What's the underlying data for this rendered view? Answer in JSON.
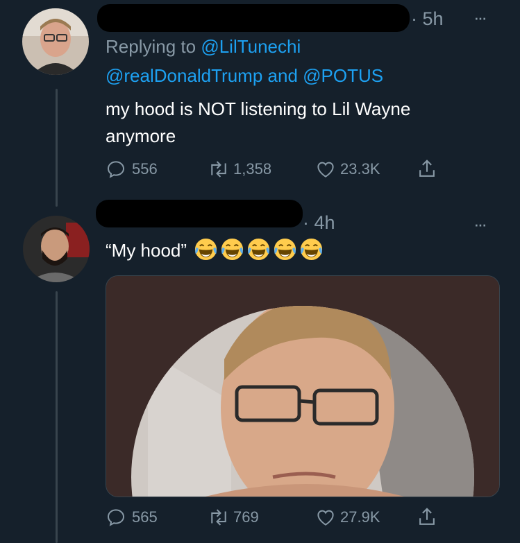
{
  "tweet1": {
    "time": "· 5h",
    "more": "···",
    "replying_prefix": "Replying to",
    "mention1": "@LilTunechi",
    "mention2": "@realDonaldTrump",
    "and": "and",
    "mention3": "@POTUS",
    "text_line1": "my hood is NOT listening to Lil Wayne",
    "text_line2": "anymore",
    "replies": "556",
    "retweets": "1,358",
    "likes": "23.3K"
  },
  "tweet2": {
    "time": "· 4h",
    "more": "···",
    "text": "“My hood”",
    "emoji": [
      "face-with-tears-of-joy-icon",
      "face-with-tears-of-joy-icon",
      "face-with-tears-of-joy-icon",
      "face-with-tears-of-joy-icon",
      "face-with-tears-of-joy-icon"
    ],
    "replies": "565",
    "retweets": "769",
    "likes": "27.9K"
  },
  "colors": {
    "background": "#15202b",
    "muted": "#8899a6",
    "link": "#1da1f2",
    "border": "#38444d"
  }
}
